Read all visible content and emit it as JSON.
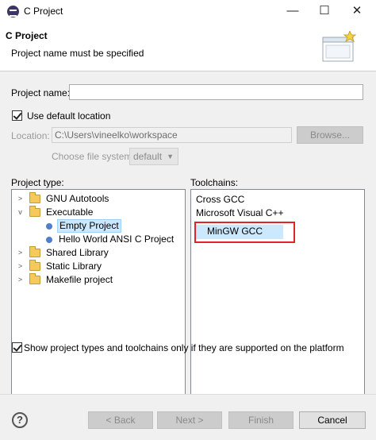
{
  "window": {
    "title": "C Project",
    "minimize": "—",
    "maximize": "☐",
    "close": "✕"
  },
  "banner": {
    "title": "C Project",
    "message": "Project name must be specified"
  },
  "form": {
    "project_name_label": "Project name:",
    "project_name_value": "",
    "use_default_label": "Use default location",
    "use_default_checked": true,
    "location_label": "Location:",
    "location_value": "C:\\Users\\vineelko\\workspace",
    "browse_label": "Browse...",
    "file_system_label": "Choose file system:",
    "file_system_value": "default"
  },
  "project_types": {
    "label": "Project type:",
    "items": [
      {
        "label": "GNU Autotools",
        "expanded": false,
        "kind": "folder"
      },
      {
        "label": "Executable",
        "expanded": true,
        "kind": "folder"
      },
      {
        "label": "Empty Project",
        "kind": "leaf",
        "selected": true
      },
      {
        "label": "Hello World ANSI C Project",
        "kind": "leaf"
      },
      {
        "label": "Shared Library",
        "expanded": false,
        "kind": "folder"
      },
      {
        "label": "Static Library",
        "expanded": false,
        "kind": "folder"
      },
      {
        "label": "Makefile project",
        "expanded": false,
        "kind": "folder"
      }
    ]
  },
  "toolchains": {
    "label": "Toolchains:",
    "items": [
      {
        "label": "Cross GCC"
      },
      {
        "label": "Microsoft Visual C++"
      },
      {
        "label": "MinGW GCC",
        "selected": true
      }
    ]
  },
  "filter": {
    "label": "Show project types and toolchains only if they are supported on the platform",
    "checked": true
  },
  "footer": {
    "help": "?",
    "back": "< Back",
    "next": "Next >",
    "finish": "Finish",
    "cancel": "Cancel"
  },
  "colors": {
    "selection": "#cce8ff",
    "highlight_box": "#e3232b",
    "folder": "#f5c95b",
    "bullet": "#4f7fc6"
  }
}
